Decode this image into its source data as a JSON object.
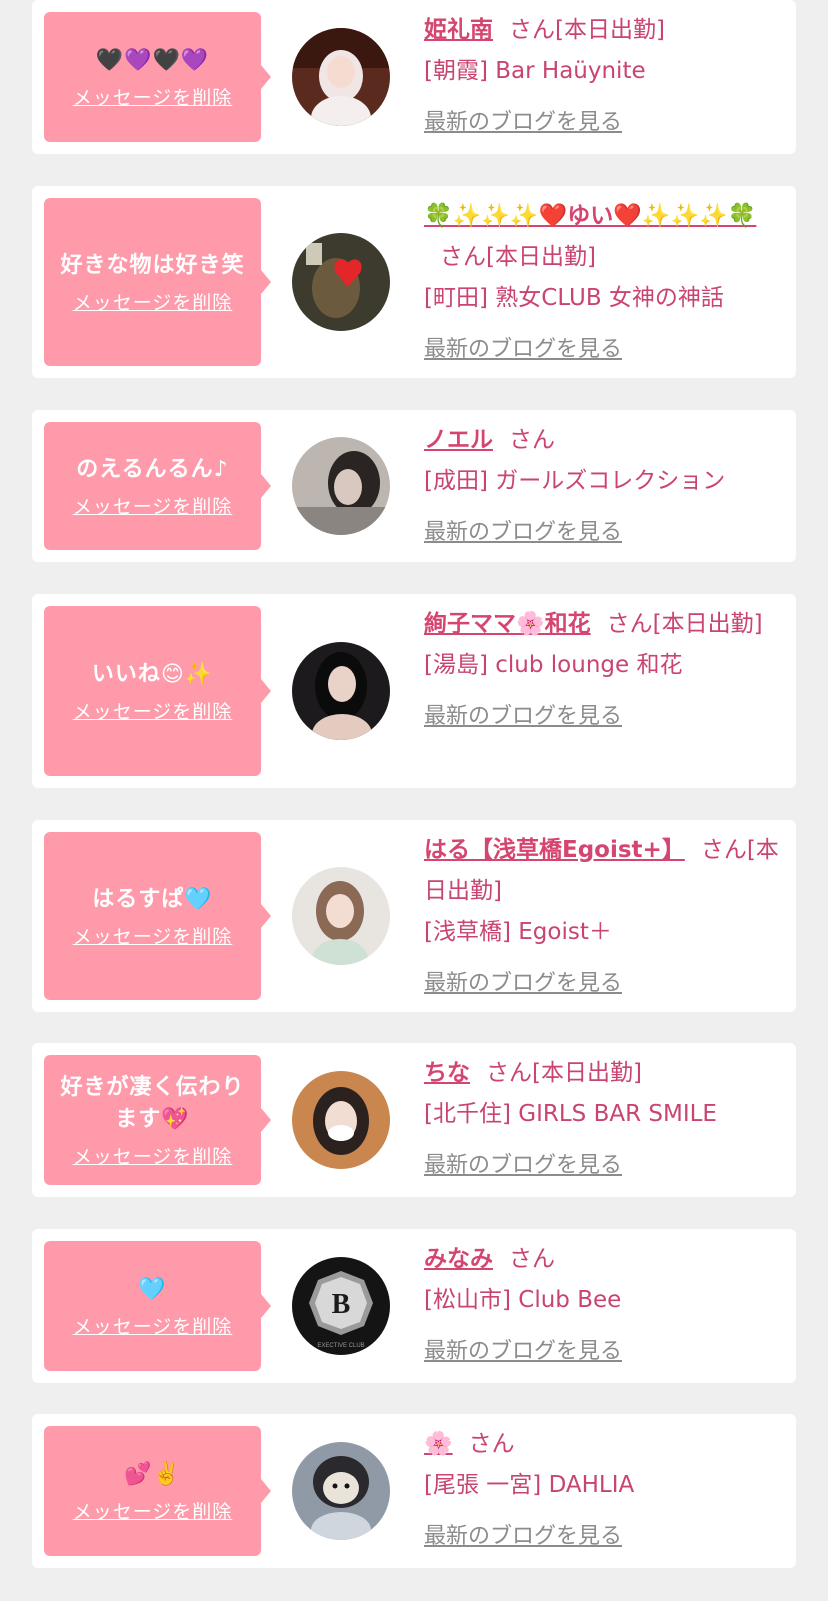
{
  "delete_label": "メッセージを削除",
  "blog_label": "最新のブログを見る",
  "colors": {
    "bubble": "#ff9aab",
    "name": "#d4466f",
    "text": "#c94470",
    "link": "#8c8c8c",
    "background": "#efefef"
  },
  "entries": [
    {
      "message": "🖤💜🖤💜",
      "name": "姫礼南",
      "suffix": "さん[本日出勤]",
      "shop": "[朝霞] Bar Haüynite",
      "avatar": "photo-woman-blonde"
    },
    {
      "message": "好きな物は好き笑",
      "name": "🍀✨✨✨❤️ゆい❤️✨✨✨🍀",
      "suffix": "さん[本日出勤]",
      "shop": "[町田] 熟女CLUB 女神の神話",
      "avatar": "photo-woman-heart"
    },
    {
      "message": "のえるんるん♪",
      "name": "ノエル",
      "suffix": "さん",
      "shop": "[成田] ガールズコレクション",
      "avatar": "photo-woman-dark"
    },
    {
      "message": "いいね😊✨",
      "name": "絢子ママ🌸和花",
      "suffix": "さん[本日出勤]",
      "shop": "[湯島] club lounge 和花",
      "avatar": "photo-woman-dark-hair"
    },
    {
      "message": "はるすぱ🩵",
      "name": "はる【浅草橋Egoist+】",
      "suffix": "さん[本日出勤]",
      "shop": "[浅草橋] Egoist＋",
      "avatar": "photo-woman-light"
    },
    {
      "message": "好きが凄く伝わります💖",
      "name": "ちな",
      "suffix": "さん[本日出勤]",
      "shop": "[北千住] GIRLS BAR SMILE",
      "avatar": "photo-woman-warm"
    },
    {
      "message": "🩵",
      "name": "みなみ",
      "suffix": "さん",
      "shop": "[松山市] Club Bee",
      "avatar": "club-logo-b",
      "logo_text": "B",
      "logo_caption": "EXECTIVE CLUB"
    },
    {
      "message": "💕✌️",
      "name": "🌸",
      "suffix": "さん",
      "shop": "[尾張 一宮] DAHLIA",
      "avatar": "photo-hamster"
    }
  ]
}
